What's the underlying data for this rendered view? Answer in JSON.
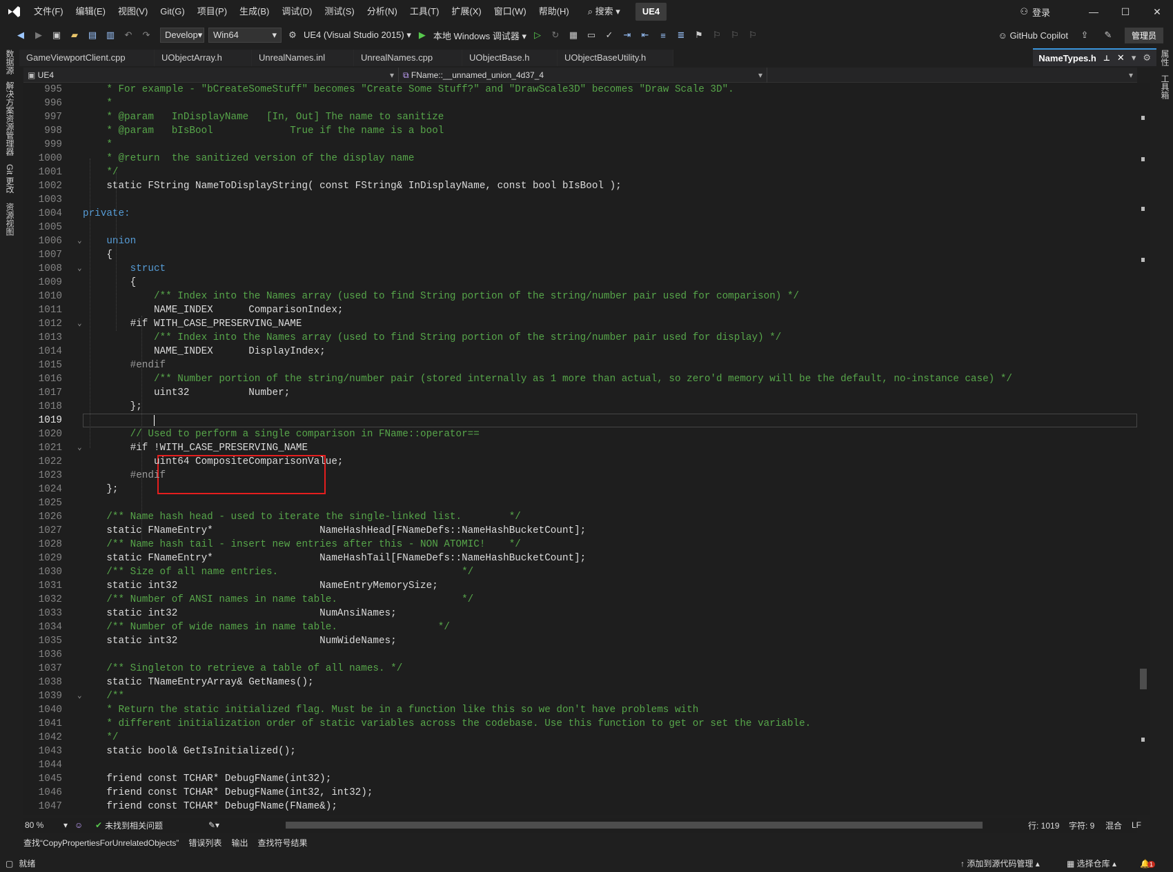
{
  "menubar": {
    "items": [
      "文件(F)",
      "编辑(E)",
      "视图(V)",
      "Git(G)",
      "项目(P)",
      "生成(B)",
      "调试(D)",
      "测试(S)",
      "分析(N)",
      "工具(T)",
      "扩展(X)",
      "窗口(W)",
      "帮助(H)"
    ],
    "search": "搜索",
    "solution": "UE4",
    "login": "登录"
  },
  "toolbar": {
    "config": "Develop",
    "platform": "Win64",
    "startup_project": "UE4 (Visual Studio 2015)",
    "debugger": "本地 Windows 调试器",
    "copilot": "GitHub Copilot",
    "admin": "管理员"
  },
  "side_tabs": [
    "数据源",
    "解决方案资源管理器",
    "Git 更改",
    "资源视图"
  ],
  "right_tabs": [
    "属性",
    "工具箱"
  ],
  "tabs": [
    "GameViewportClient.cpp",
    "UObjectArray.h",
    "UnrealNames.inl",
    "UnrealNames.cpp",
    "UObjectBase.h",
    "UObjectBaseUtility.h"
  ],
  "active_tab": "NameTypes.h",
  "nav": {
    "project": "UE4",
    "scope": "FName::__unnamed_union_4d37_4"
  },
  "status": {
    "zoom": "80 %",
    "issues": "未找到相关问题",
    "line": "行: 1019",
    "char": "字符: 9",
    "mixed": "混合",
    "eol": "LF"
  },
  "panels": [
    "查找“CopyPropertiesForUnrelatedObjects”",
    "错误列表",
    "输出",
    "查找符号结果"
  ],
  "statusbar": {
    "ready": "就绪",
    "add_source": "添加到源代码管理",
    "select_repo": "选择仓库",
    "notifications": "1"
  },
  "code": [
    {
      "n": "995",
      "cls": "c",
      "t": "    * For example - \"bCreateSomeStuff\" becomes \"Create Some Stuff?\" and \"DrawScale3D\" becomes \"Draw Scale 3D\"."
    },
    {
      "n": "996",
      "cls": "c",
      "t": "    *"
    },
    {
      "n": "997",
      "cls": "c",
      "t": "    * @param   InDisplayName   [In, Out] The name to sanitize"
    },
    {
      "n": "998",
      "cls": "c",
      "t": "    * @param   bIsBool             True if the name is a bool"
    },
    {
      "n": "999",
      "cls": "c",
      "t": "    *"
    },
    {
      "n": "1000",
      "cls": "c",
      "t": "    * @return  the sanitized version of the display name"
    },
    {
      "n": "1001",
      "cls": "c",
      "t": "    */"
    },
    {
      "n": "1002",
      "cls": "",
      "t": "    static FString NameToDisplayString( const FString& InDisplayName, const bool bIsBool );"
    },
    {
      "n": "1003",
      "cls": "",
      "t": ""
    },
    {
      "n": "1004",
      "cls": "k",
      "t": "private:"
    },
    {
      "n": "1005",
      "cls": "",
      "t": ""
    },
    {
      "n": "1006",
      "cls": "k",
      "t": "    union"
    },
    {
      "n": "1007",
      "cls": "",
      "t": "    {"
    },
    {
      "n": "1008",
      "cls": "k",
      "t": "        struct"
    },
    {
      "n": "1009",
      "cls": "",
      "t": "        {"
    },
    {
      "n": "1010",
      "cls": "c",
      "t": "            /** Index into the Names array (used to find String portion of the string/number pair used for comparison) */"
    },
    {
      "n": "1011",
      "cls": "",
      "t": "            NAME_INDEX      ComparisonIndex;"
    },
    {
      "n": "1012",
      "cls": "",
      "t": "        #if WITH_CASE_PRESERVING_NAME"
    },
    {
      "n": "1013",
      "cls": "c",
      "t": "            /** Index into the Names array (used to find String portion of the string/number pair used for display) */"
    },
    {
      "n": "1014",
      "cls": "",
      "t": "            NAME_INDEX      DisplayIndex;"
    },
    {
      "n": "1015",
      "cls": "p",
      "t": "        #endif"
    },
    {
      "n": "1016",
      "cls": "c",
      "t": "            /** Number portion of the string/number pair (stored internally as 1 more than actual, so zero'd memory will be the default, no-instance case) */"
    },
    {
      "n": "1017",
      "cls": "",
      "t": "            uint32          Number;"
    },
    {
      "n": "1018",
      "cls": "",
      "t": "        };"
    },
    {
      "n": "1019",
      "cls": "",
      "t": ""
    },
    {
      "n": "1020",
      "cls": "c",
      "t": "        // Used to perform a single comparison in FName::operator=="
    },
    {
      "n": "1021",
      "cls": "",
      "t": "        #if !WITH_CASE_PRESERVING_NAME"
    },
    {
      "n": "1022",
      "cls": "",
      "t": "            uint64 CompositeComparisonValue;"
    },
    {
      "n": "1023",
      "cls": "p",
      "t": "        #endif"
    },
    {
      "n": "1024",
      "cls": "",
      "t": "    };"
    },
    {
      "n": "1025",
      "cls": "",
      "t": ""
    },
    {
      "n": "1026",
      "cls": "c",
      "t": "    /** Name hash head - used to iterate the single-linked list.        */"
    },
    {
      "n": "1027",
      "cls": "",
      "t": "    static FNameEntry*                  NameHashHead[FNameDefs::NameHashBucketCount];"
    },
    {
      "n": "1028",
      "cls": "c",
      "t": "    /** Name hash tail - insert new entries after this - NON ATOMIC!    */"
    },
    {
      "n": "1029",
      "cls": "",
      "t": "    static FNameEntry*                  NameHashTail[FNameDefs::NameHashBucketCount];"
    },
    {
      "n": "1030",
      "cls": "c",
      "t": "    /** Size of all name entries.                               */"
    },
    {
      "n": "1031",
      "cls": "",
      "t": "    static int32                        NameEntryMemorySize;"
    },
    {
      "n": "1032",
      "cls": "c",
      "t": "    /** Number of ANSI names in name table.                     */"
    },
    {
      "n": "1033",
      "cls": "",
      "t": "    static int32                        NumAnsiNames;"
    },
    {
      "n": "1034",
      "cls": "c",
      "t": "    /** Number of wide names in name table.                 */"
    },
    {
      "n": "1035",
      "cls": "",
      "t": "    static int32                        NumWideNames;"
    },
    {
      "n": "1036",
      "cls": "",
      "t": ""
    },
    {
      "n": "1037",
      "cls": "c",
      "t": "    /** Singleton to retrieve a table of all names. */"
    },
    {
      "n": "1038",
      "cls": "",
      "t": "    static TNameEntryArray& GetNames();"
    },
    {
      "n": "1039",
      "cls": "c",
      "t": "    /**"
    },
    {
      "n": "1040",
      "cls": "c",
      "t": "    * Return the static initialized flag. Must be in a function like this so we don't have problems with"
    },
    {
      "n": "1041",
      "cls": "c",
      "t": "    * different initialization order of static variables across the codebase. Use this function to get or set the variable."
    },
    {
      "n": "1042",
      "cls": "c",
      "t": "    */"
    },
    {
      "n": "1043",
      "cls": "",
      "t": "    static bool& GetIsInitialized();"
    },
    {
      "n": "1044",
      "cls": "",
      "t": ""
    },
    {
      "n": "1045",
      "cls": "",
      "t": "    friend const TCHAR* DebugFName(int32);"
    },
    {
      "n": "1046",
      "cls": "",
      "t": "    friend const TCHAR* DebugFName(int32, int32);"
    },
    {
      "n": "1047",
      "cls": "",
      "t": "    friend const TCHAR* DebugFName(FName&);"
    }
  ]
}
